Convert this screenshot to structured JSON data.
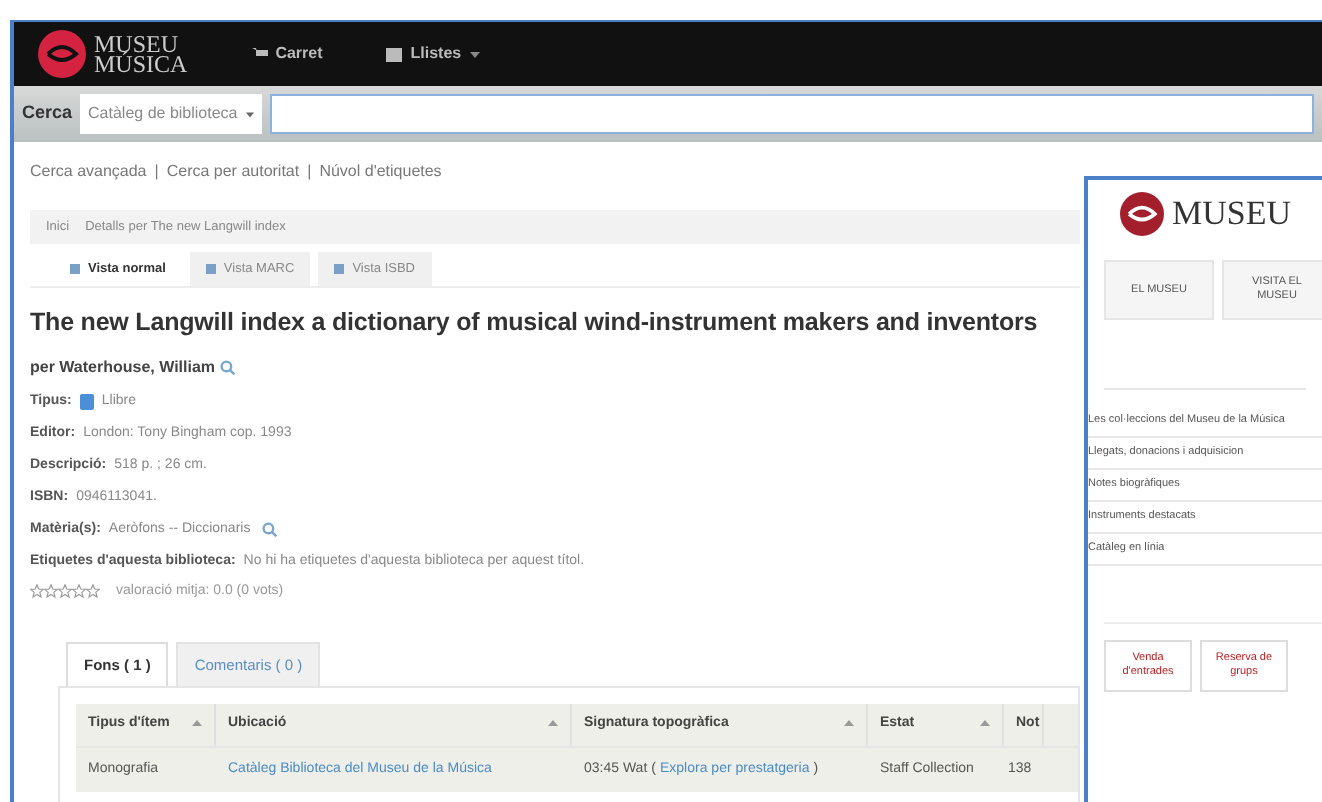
{
  "navbar": {
    "logo": [
      "MUSEU",
      "MÚSICA"
    ],
    "items": [
      {
        "label": "Carret",
        "kind": "cart"
      },
      {
        "label": "Llistes",
        "kind": "lists"
      }
    ]
  },
  "search": {
    "label": "Cerca",
    "scope": "Catàleg de biblioteca"
  },
  "links": [
    "Cerca avançada",
    "Cerca per autoritat",
    "Núvol d'etiquetes"
  ],
  "link_separator": "|",
  "breadcrumb": [
    "Inici",
    "Detalls per The new Langwill index"
  ],
  "views": [
    {
      "label": "Vista normal",
      "selected": true
    },
    {
      "label": "Vista MARC",
      "selected": false
    },
    {
      "label": "Vista ISBD",
      "selected": false
    }
  ],
  "record": {
    "title": "The new Langwill index a dictionary of musical wind-instrument makers and inventors",
    "author": "per Waterhouse, William",
    "fields": [
      {
        "label": "Tipus:",
        "value": "Llibre",
        "kind": "type"
      },
      {
        "label": "Editor:",
        "value": "London: Tony Bingham cop. 1993",
        "kind": "text"
      },
      {
        "label": "Descripció:",
        "value": "518 p. ; 26 cm.",
        "kind": "text"
      },
      {
        "label": "ISBN:",
        "value": "0946113041.",
        "kind": "text"
      },
      {
        "label": "Matèria(s):",
        "value": "Aeròfons -- Diccionaris",
        "kind": "search"
      },
      {
        "label": "Etiquetes d'aquesta biblioteca:",
        "value": "No hi ha etiquetes d'aquesta biblioteca per aquest títol.",
        "kind": "text"
      }
    ],
    "rating": {
      "stars": 0,
      "text": "valoració mitja: 0.0 (0 vots)"
    }
  },
  "holdings_tabs": [
    {
      "label": "Fons ( 1 )",
      "selected": true
    },
    {
      "label": "Comentaris ( 0 )",
      "selected": false
    }
  ],
  "table": {
    "columns": [
      "Tipus d'ítem",
      "Ubicació",
      "Signatura topogràfica",
      "Estat",
      "Not"
    ],
    "rows": [
      {
        "type": "Monografia",
        "location": "Catàleg Biblioteca del Museu de la Música",
        "call_number": "03:45 Wat",
        "browse": "Explora per prestatgeria",
        "brackets": [
          "(",
          ")"
        ],
        "status": "Staff Collection",
        "column_5": "138"
      }
    ]
  },
  "museum_window": {
    "logo": "MUSEU",
    "tabs": [
      "EL MUSEU",
      "VISITA EL MUSEU"
    ],
    "menu": [
      "Les col·leccions del Museu de la Música",
      "Llegats, donacions i adquisicion",
      "Notes biogràfiques",
      "Instruments destacats",
      "Catàleg en línia"
    ],
    "buttons": [
      "Venda d'entrades",
      "Reserva de grups"
    ]
  }
}
